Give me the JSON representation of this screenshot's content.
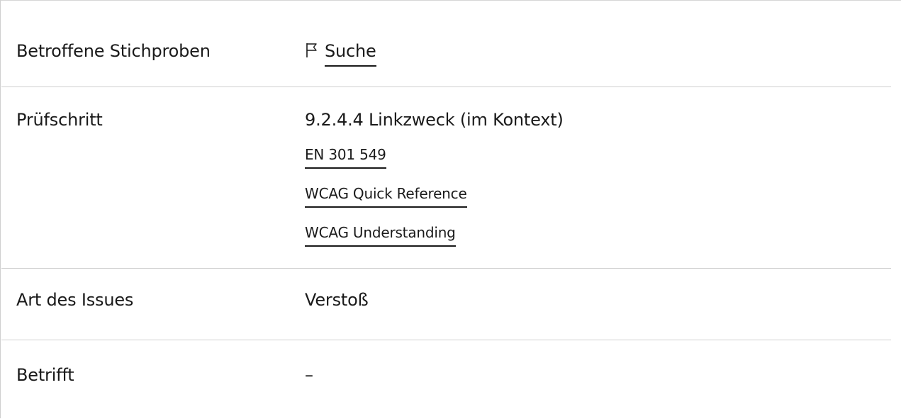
{
  "rows": [
    {
      "label": "Betroffene Stichproben",
      "value_link": "Suche",
      "icon": "flag-icon"
    },
    {
      "label": "Prüfschritt",
      "value": "9.2.4.4 Linkzweck (im Kontext)",
      "links": [
        "EN 301 549",
        "WCAG Quick Reference",
        "WCAG Understanding"
      ]
    },
    {
      "label": "Art des Issues",
      "value": "Verstoß"
    },
    {
      "label": "Betrifft",
      "value": "–"
    }
  ]
}
